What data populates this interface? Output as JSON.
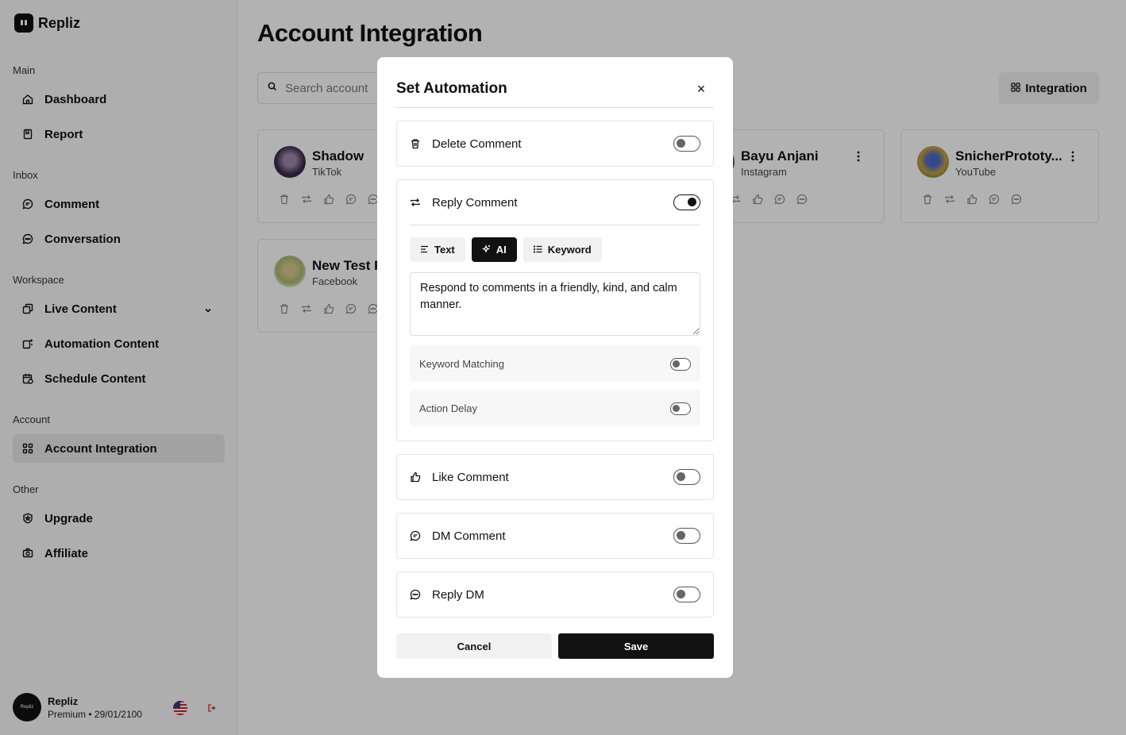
{
  "brand": {
    "name": "Repliz"
  },
  "sidebar": {
    "sections": [
      {
        "label": "Main",
        "items": [
          {
            "label": "Dashboard",
            "icon": "home-icon"
          },
          {
            "label": "Report",
            "icon": "report-icon"
          }
        ]
      },
      {
        "label": "Inbox",
        "items": [
          {
            "label": "Comment",
            "icon": "comment-icon"
          },
          {
            "label": "Conversation",
            "icon": "conversation-icon"
          }
        ]
      },
      {
        "label": "Workspace",
        "items": [
          {
            "label": "Live Content",
            "icon": "copy-icon"
          },
          {
            "label": "Automation Content",
            "icon": "automation-icon"
          },
          {
            "label": "Schedule Content",
            "icon": "calendar-icon"
          }
        ]
      },
      {
        "label": "Account",
        "items": [
          {
            "label": "Account Integration",
            "icon": "grid-icon",
            "active": true
          }
        ]
      },
      {
        "label": "Other",
        "items": [
          {
            "label": "Upgrade",
            "icon": "shield-icon"
          },
          {
            "label": "Affiliate",
            "icon": "camera-icon"
          }
        ]
      }
    ]
  },
  "user": {
    "name": "Repliz",
    "avatar_text": "Repliz",
    "plan": "Premium",
    "separator": "•",
    "expiry": "29/01/2100"
  },
  "main": {
    "title": "Account Integration",
    "search_placeholder": "Search account",
    "integration_button": "Integration",
    "cards": [
      {
        "name": "Shadow",
        "platform": "TikTok",
        "color": "#3a2a4a"
      },
      {
        "name": "Bayu Anjani",
        "platform": "Instagram",
        "color": "#8a6a5a"
      },
      {
        "name": "SnicherPrototy...",
        "platform": "YouTube",
        "color": "#c8a040"
      },
      {
        "name": "New Test P",
        "platform": "Facebook",
        "color": "#a8b870"
      }
    ]
  },
  "modal": {
    "title": "Set Automation",
    "close": "×",
    "options": {
      "delete": {
        "label": "Delete Comment",
        "enabled": false
      },
      "reply": {
        "label": "Reply Comment",
        "enabled": true
      },
      "like": {
        "label": "Like Comment",
        "enabled": false
      },
      "dm": {
        "label": "DM Comment",
        "enabled": false
      },
      "reply_dm": {
        "label": "Reply DM",
        "enabled": false
      }
    },
    "tabs": [
      {
        "label": "Text"
      },
      {
        "label": "AI",
        "active": true
      },
      {
        "label": "Keyword"
      }
    ],
    "prompt": "Respond to comments in a friendly, kind, and calm manner.",
    "keyword_matching": {
      "label": "Keyword Matching",
      "enabled": false
    },
    "action_delay": {
      "label": "Action Delay",
      "enabled": false
    },
    "cancel": "Cancel",
    "save": "Save"
  },
  "colors": {
    "accent": "#111111",
    "overlay": "rgba(0,0,0,0.30)",
    "active_nav": "#e8e8e8"
  }
}
